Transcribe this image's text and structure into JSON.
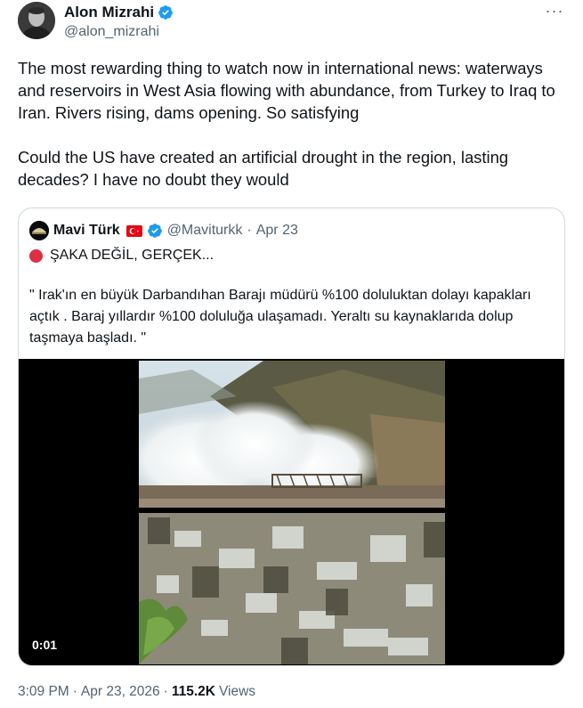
{
  "author": {
    "name": "Alon Mizrahi",
    "handle": "@alon_mizrahi"
  },
  "more_label": "···",
  "tweet": {
    "paragraphs": [
      "The most rewarding thing to watch now in international news: waterways and reservoirs in West Asia flowing with abundance, from Turkey to Iraq to Iran. Rivers rising, dams opening. So satisfying",
      "Could the US have created an artificial drought in the region, lasting decades? I have no doubt they would"
    ]
  },
  "quote": {
    "name": "Mavi Türk",
    "handle": "@Maviturkk",
    "separator": "·",
    "date": "Apr 23",
    "line1": "ŞAKA DEĞİL, GERÇEK...",
    "text": "\" Irak'ın en büyük Darbandıhan Barajı müdürü %100 doluluktan dolayı kapakları açtık . Baraj yıllardır %100 doluluğa ulaşamadı. Yeraltı su kaynaklarıda dolup taşmaya başladı. \"",
    "video_time": "0:01"
  },
  "footer": {
    "time": "3:09 PM",
    "separator": "·",
    "date": "Apr 23, 2026",
    "separator2": "·",
    "views_count": "115.2K",
    "views_label": "Views"
  },
  "colors": {
    "verified": "#1d9bf0",
    "muted": "#536471",
    "text": "#0f1419",
    "border": "#cfd9de",
    "alert_dot": "#dd2e44"
  }
}
